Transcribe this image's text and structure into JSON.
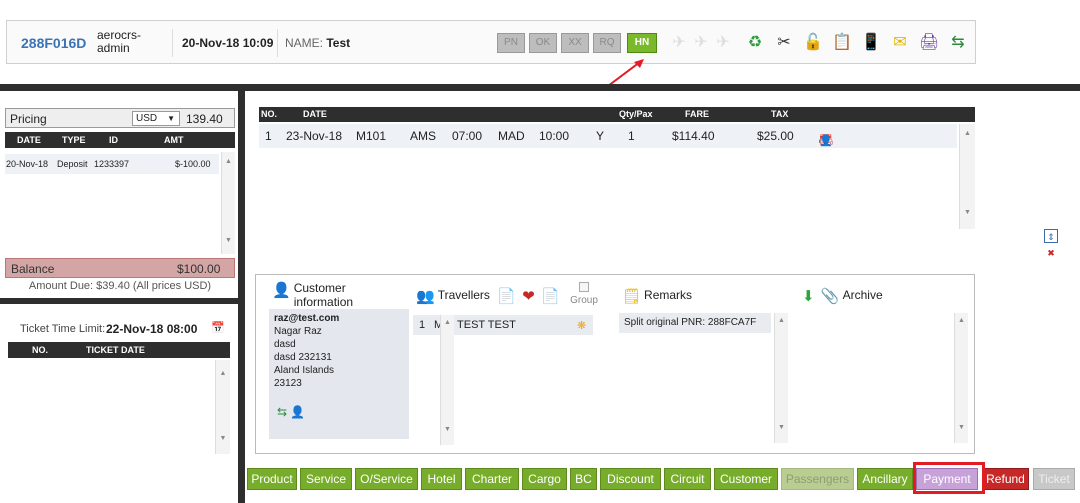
{
  "header": {
    "pnr": "288F016D",
    "user": "aerocrs-admin",
    "datetime": "20-Nov-18 10:09",
    "name_label": "NAME:",
    "name_value": "Test",
    "status_buttons": [
      "PN",
      "OK",
      "XX",
      "RQ",
      "HN"
    ],
    "active_status": "HN"
  },
  "pricing": {
    "title": "Pricing",
    "currency": "USD",
    "total": "139.40",
    "columns": [
      "DATE",
      "TYPE",
      "ID",
      "AMT"
    ],
    "rows": [
      {
        "date": "20-Nov-18",
        "type": "Deposit",
        "id": "1233397",
        "amt": "$-100.00"
      }
    ],
    "balance_label": "Balance",
    "balance_value": "$100.00",
    "amount_due": "Amount Due: $39.40 (All prices USD)"
  },
  "ticket_limit": {
    "label": "Ticket Time Limit:",
    "value": "22-Nov-18 08:00",
    "columns": [
      "NO.",
      "TICKET DATE"
    ]
  },
  "segments": {
    "columns": [
      "NO.",
      "DATE",
      "Qty/Pax",
      "FARE",
      "TAX"
    ],
    "rows": [
      {
        "no": "1",
        "date": "23-Nov-18",
        "flight": "M101",
        "from": "AMS",
        "dep": "07:00",
        "to": "MAD",
        "arr": "10:00",
        "cls": "Y",
        "qty": "1",
        "fare": "$114.40",
        "tax": "$25.00"
      }
    ]
  },
  "customer": {
    "title": "Customer information",
    "email": "raz@test.com",
    "lines": [
      "Nagar Raz",
      "dasd",
      "dasd 232131",
      "Aland Islands",
      "23123"
    ]
  },
  "travellers": {
    "title": "Travellers",
    "group_label": "Group",
    "rows": [
      {
        "no": "1",
        "name": "MR. TEST TEST"
      }
    ]
  },
  "remarks": {
    "title": "Remarks",
    "rows": [
      "Split original PNR: 288FCA7F"
    ]
  },
  "archive": {
    "title": "Archive"
  },
  "tabs": [
    "Product",
    "Service",
    "O/Service",
    "Hotel",
    "Charter",
    "Cargo",
    "BC",
    "Discount",
    "Circuit",
    "Customer",
    "Passengers",
    "Ancillary",
    "Payment",
    "Refund",
    "Ticket"
  ]
}
